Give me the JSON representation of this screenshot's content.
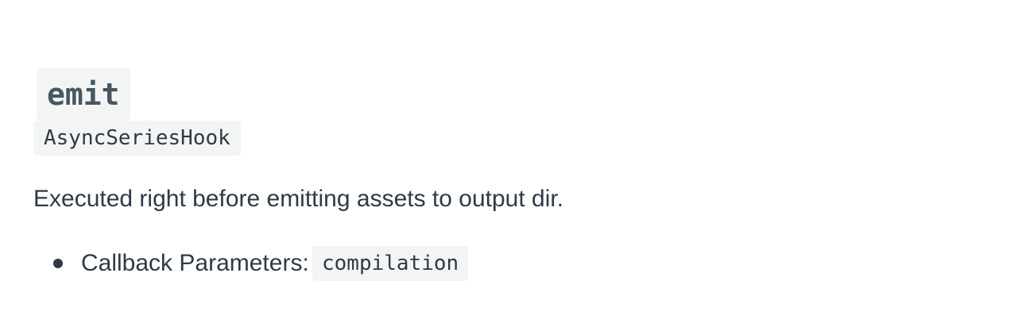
{
  "section": {
    "hook_name": "emit",
    "hook_type": "AsyncSeriesHook",
    "description": "Executed right before emitting assets to output dir.",
    "params": [
      {
        "label": "Callback Parameters:",
        "code": "compilation"
      }
    ]
  },
  "colors": {
    "text": "#2f3a44",
    "code_background": "#f3f5f5",
    "heading_text": "#465663"
  }
}
